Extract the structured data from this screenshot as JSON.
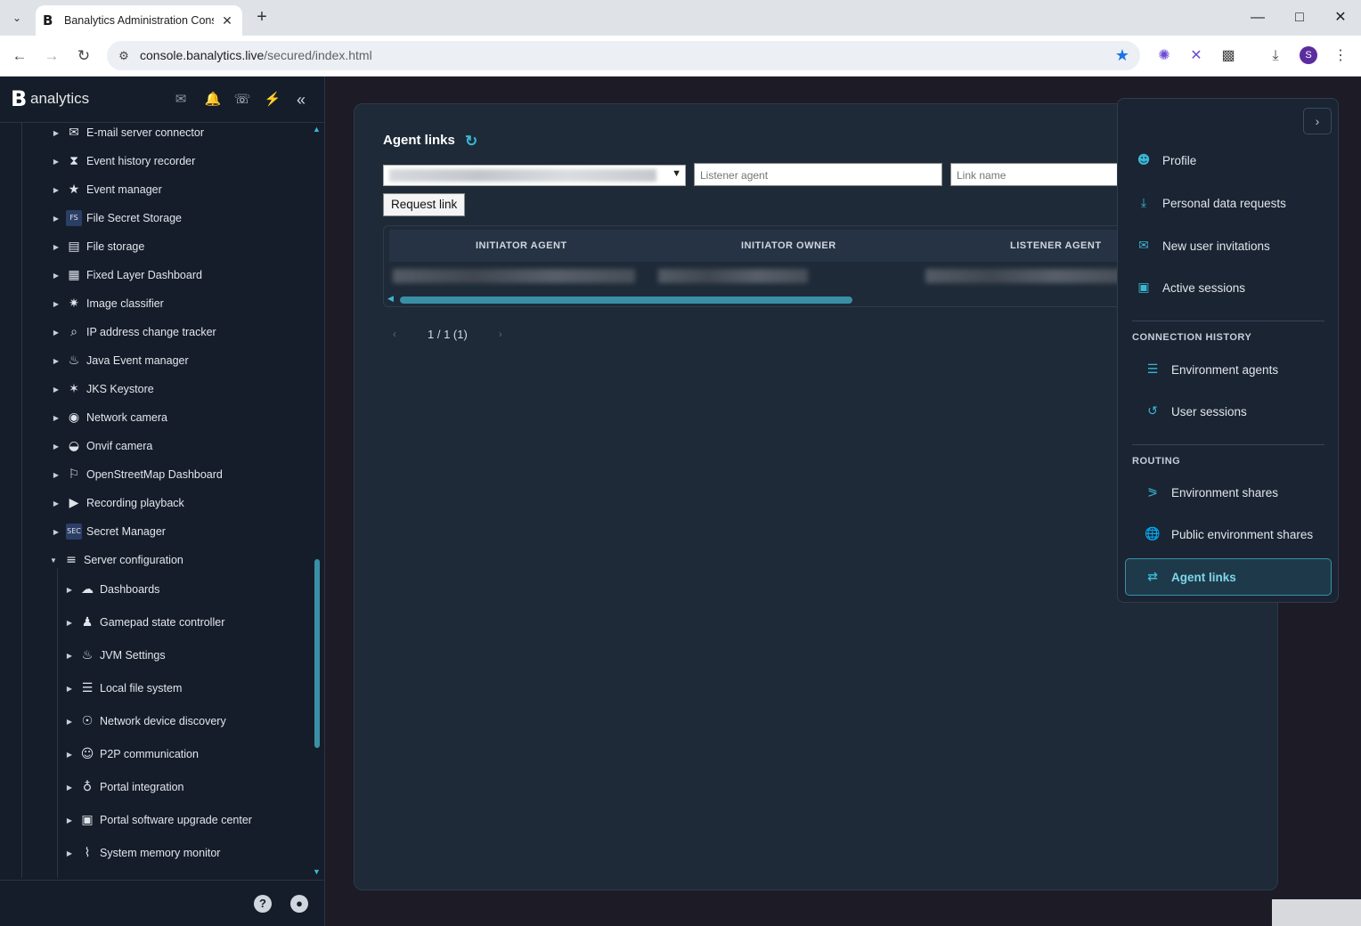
{
  "browser": {
    "tab_title": "Banalytics Administration Cons",
    "url_host": "console.banalytics.live",
    "url_path": "/secured/index.html",
    "profile_initial": "S"
  },
  "sidebar": {
    "logo_text": "analytics",
    "tree_level1": [
      {
        "label": "E-mail server connector",
        "icon": "email-server-icon"
      },
      {
        "label": "Event history recorder",
        "icon": "history-icon"
      },
      {
        "label": "Event manager",
        "icon": "event-icon"
      },
      {
        "label": "File Secret Storage",
        "icon": "fs-icon",
        "glyph": "FS"
      },
      {
        "label": "File storage",
        "icon": "storage-icon"
      },
      {
        "label": "Fixed Layer Dashboard",
        "icon": "grid-icon"
      },
      {
        "label": "Image classifier",
        "icon": "classifier-icon"
      },
      {
        "label": "IP address change tracker",
        "icon": "magnifier-icon"
      },
      {
        "label": "Java Event manager",
        "icon": "java-icon"
      },
      {
        "label": "JKS Keystore",
        "icon": "keystore-icon"
      },
      {
        "label": "Network camera",
        "icon": "camera-icon"
      },
      {
        "label": "Onvif camera",
        "icon": "onvif-icon"
      },
      {
        "label": "OpenStreetMap Dashboard",
        "icon": "map-icon"
      },
      {
        "label": "Recording playback",
        "icon": "playback-icon"
      },
      {
        "label": "Secret Manager",
        "icon": "sec-icon",
        "glyph": "SEC"
      },
      {
        "label": "Server configuration",
        "icon": "server-config-icon"
      }
    ],
    "tree_level2": [
      {
        "label": "Dashboards",
        "icon": "cloud-icon"
      },
      {
        "label": "Gamepad state controller",
        "icon": "gamepad-icon"
      },
      {
        "label": "JVM Settings",
        "icon": "java-icon"
      },
      {
        "label": "Local file system",
        "icon": "database-icon"
      },
      {
        "label": "Network device discovery",
        "icon": "discovery-icon"
      },
      {
        "label": "P2P communication",
        "icon": "p2p-icon"
      },
      {
        "label": "Portal integration",
        "icon": "globe-icon"
      },
      {
        "label": "Portal software upgrade center",
        "icon": "upgrade-icon"
      },
      {
        "label": "System memory monitor",
        "icon": "memory-icon"
      }
    ]
  },
  "main": {
    "title": "Agent links",
    "listener_placeholder": "Listener agent",
    "link_name_placeholder": "Link name",
    "request_button": "Request link",
    "table": {
      "columns": [
        "INITIATOR AGENT",
        "INITIATOR OWNER",
        "LISTENER AGENT"
      ]
    },
    "pager_text": "1 / 1 (1)"
  },
  "flyout": {
    "items": [
      {
        "label": "Profile",
        "icon": "user-circle-icon"
      },
      {
        "label": "Personal data requests",
        "icon": "download-icon"
      },
      {
        "label": "New user invitations",
        "icon": "envelope-icon"
      },
      {
        "label": "Active sessions",
        "icon": "monitor-icon"
      }
    ],
    "connection_history_header": "CONNECTION HISTORY",
    "connection_history": [
      {
        "label": "Environment agents",
        "icon": "server-icon"
      },
      {
        "label": "User sessions",
        "icon": "history-icon"
      }
    ],
    "routing_header": "ROUTING",
    "routing": [
      {
        "label": "Environment shares",
        "icon": "share-icon"
      },
      {
        "label": "Public environment shares",
        "icon": "globe-icon"
      },
      {
        "label": "Agent links",
        "icon": "exchange-icon"
      }
    ]
  },
  "colors": {
    "accent": "#3ab7d3",
    "sidebar_bg": "#151d2a",
    "panel_bg": "#1e2a38",
    "bell": "#e53935",
    "plug": "#4caf50"
  }
}
